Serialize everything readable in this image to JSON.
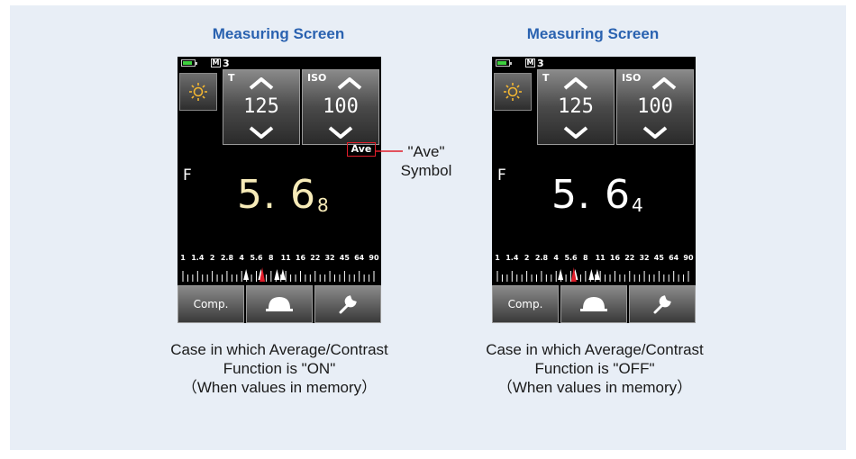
{
  "left": {
    "title": "Measuring Screen",
    "status": {
      "mem_box": "M",
      "mem_num": "3"
    },
    "t_label": "T",
    "t_value": "125",
    "iso_label": "ISO",
    "iso_value": "100",
    "f_label": "F",
    "f_main": "5. 6",
    "f_sub": "8",
    "ave_badge": "Ave",
    "comp_label": "Comp.",
    "caption": [
      "Case in which Average/Contrast",
      "Function is \"ON\"",
      "（When values in memory）"
    ]
  },
  "right": {
    "title": "Measuring Screen",
    "status": {
      "mem_box": "M",
      "mem_num": "3"
    },
    "t_label": "T",
    "t_value": "125",
    "iso_label": "ISO",
    "iso_value": "100",
    "f_label": "F",
    "f_main": "5. 6",
    "f_sub": "4",
    "comp_label": "Comp.",
    "caption": [
      "Case in which  Average/Contrast",
      "Function is \"OFF\"",
      "（When values in memory）"
    ]
  },
  "callout": {
    "line1": "\"Ave\"",
    "line2": "Symbol"
  },
  "scale_labels": [
    "1",
    "1.4",
    "2",
    "2.8",
    "4",
    "5.6",
    "8",
    "11",
    "16",
    "22",
    "32",
    "45",
    "64",
    "90"
  ],
  "icons": {
    "mode": "sun-icon",
    "up": "chevron-up-icon",
    "down": "chevron-down-icon",
    "measure": "dome-button-icon",
    "settings": "wrench-icon"
  },
  "colors": {
    "accent_title": "#2a62b0",
    "ave_highlight": "#e01d2a",
    "f_value_left": "#f7ebb8",
    "battery": "#3fd13f",
    "background": "#e8eef6"
  }
}
